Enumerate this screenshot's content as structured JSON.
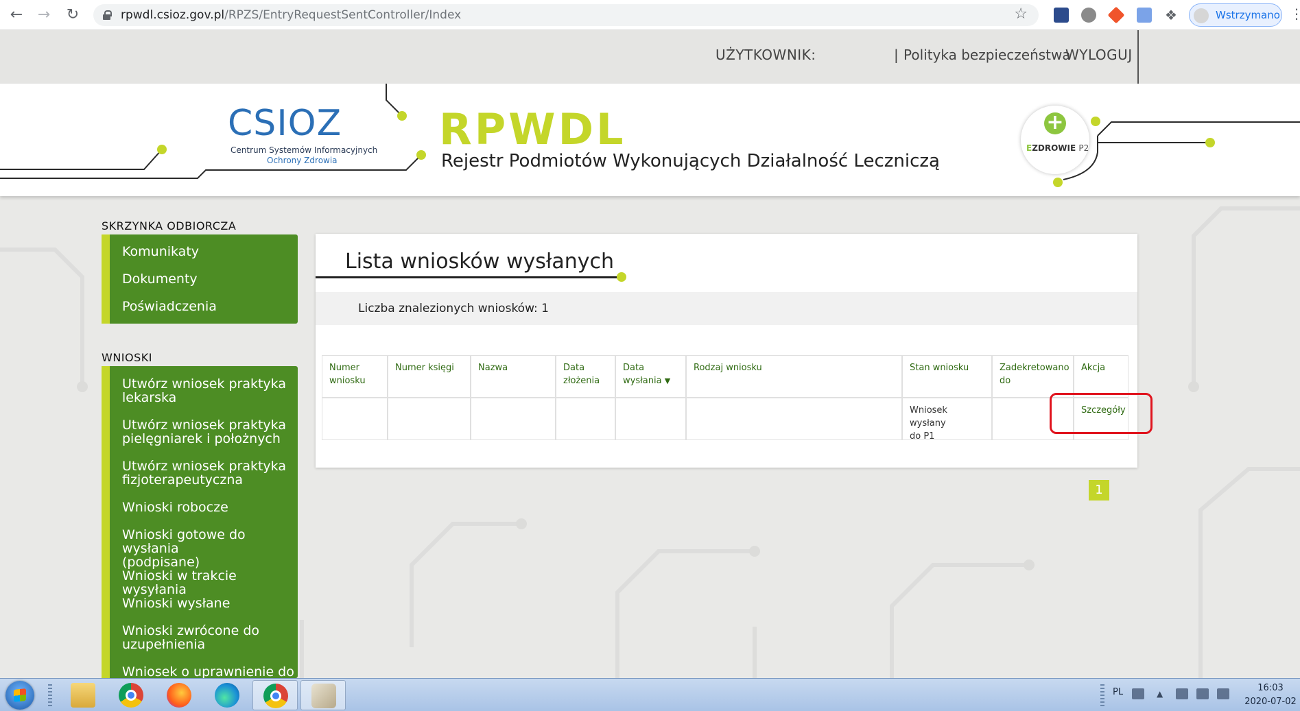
{
  "browser": {
    "url_host": "rpwdl.csioz.gov.pl",
    "url_path": "/RPZS/EntryRequestSentController/Index",
    "profile_label": "Wstrzymano"
  },
  "userbar": {
    "user_label": "UŻYTKOWNIK:",
    "separator": "|",
    "policy_link": "Polityka bezpieczeństwa",
    "logout_link": "WYLOGUJ"
  },
  "header": {
    "csioz_logo": "CSIOZ",
    "csioz_line1": "Centrum Systemów Informacyjnych",
    "csioz_line2": "Ochrony Zdrowia",
    "app_title": "RPWDL",
    "app_subtitle": "Rejestr Podmiotów Wykonujących Działalność Leczniczą",
    "ezdrowie_e": "E",
    "ezdrowie_rest": "ZDROWIE",
    "ezdrowie_p2": "P2",
    "accent_color": "#c4d62a",
    "green_color": "#4d8d24"
  },
  "sidebar": {
    "inbox_label": "SKRZYNKA ODBIORCZA",
    "inbox_items": [
      {
        "label": "Komunikaty"
      },
      {
        "label": "Dokumenty"
      },
      {
        "label": "Poświadczenia"
      }
    ],
    "requests_label": "WNIOSKI",
    "request_items": [
      {
        "line1": "Utwórz wniosek praktyka",
        "line2": "lekarska"
      },
      {
        "line1": "Utwórz wniosek praktyka",
        "line2": "pielęgniarek i położnych"
      },
      {
        "line1": "Utwórz wniosek praktyka",
        "line2": "fizjoterapeutyczna"
      },
      {
        "line1": "Wnioski robocze",
        "line2": ""
      },
      {
        "line1": "Wnioski gotowe do wysłania",
        "line2": "(podpisane)"
      },
      {
        "line1": "Wnioski w trakcie wysyłania",
        "line2": ""
      },
      {
        "line1": "Wnioski wysłane",
        "line2": ""
      },
      {
        "line1": "Wnioski zwrócone do",
        "line2": "uzupełnienia"
      },
      {
        "line1": "Wniosek o uprawnienie do",
        "line2": ""
      }
    ]
  },
  "main": {
    "title": "Lista wniosków wysłanych",
    "count_text": "Liczba znalezionych wniosków: 1",
    "columns": [
      {
        "l1": "Numer",
        "l2": "wniosku"
      },
      {
        "l1": "Numer księgi",
        "l2": ""
      },
      {
        "l1": "Nazwa",
        "l2": ""
      },
      {
        "l1": "Data",
        "l2": "złożenia"
      },
      {
        "l1": "Data",
        "l2": "wysłania"
      },
      {
        "l1": "Rodzaj wniosku",
        "l2": ""
      },
      {
        "l1": "Stan wniosku",
        "l2": ""
      },
      {
        "l1": "Zadekretowano",
        "l2": "do"
      },
      {
        "l1": "Akcja",
        "l2": ""
      }
    ],
    "sort_indicator": "chevron-down-icon",
    "rows": [
      {
        "numer_wniosku": "",
        "numer_ksiegi": "",
        "nazwa": "",
        "data_zlozenia": "",
        "data_wyslania": "",
        "rodzaj": "",
        "stan_l1": "Wniosek wysłany",
        "stan_l2": "do P1",
        "zadekretowano": "",
        "akcja": "Szczegóły"
      }
    ],
    "page": "1"
  },
  "taskbar": {
    "language": "PL",
    "time": "16:03",
    "date": "2020-07-02"
  }
}
